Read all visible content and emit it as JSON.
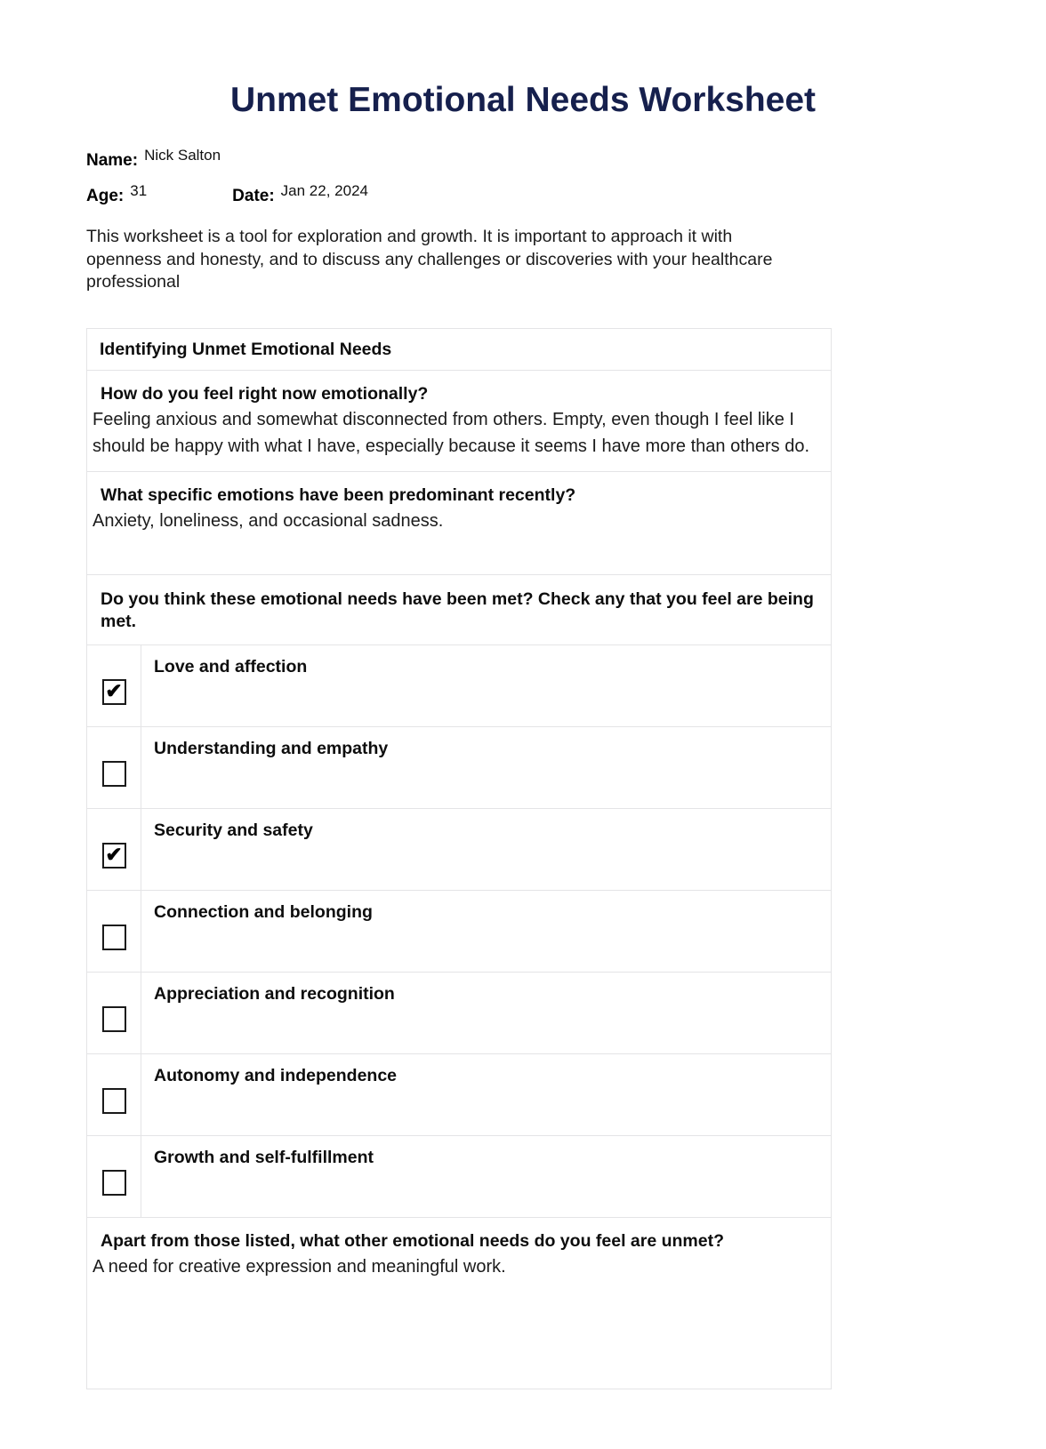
{
  "document": {
    "title": "Unmet Emotional Needs Worksheet",
    "title_color": "#16204d"
  },
  "identity": {
    "name_label": "Name:",
    "name_value": "Nick Salton",
    "age_label": "Age:",
    "age_value": "31",
    "date_label": "Date:",
    "date_value": "Jan 22, 2024"
  },
  "intro": {
    "text": "This worksheet is a tool for exploration and growth. It is important to approach it with openness and honesty, and to discuss any challenges or discoveries with your healthcare professional"
  },
  "section": {
    "header": "Identifying Unmet Emotional Needs",
    "questions": [
      {
        "question": "How do you feel right now emotionally?",
        "answer": "Feeling anxious and somewhat disconnected from others. Empty, even though I feel like I should be happy with what I have, especially because it seems I have more than others do."
      },
      {
        "question": "What specific emotions have been predominant recently?",
        "answer": "Anxiety, loneliness, and occasional sadness."
      }
    ],
    "checklist_prompt": "Do you think these emotional needs have been met? Check any that you feel are being met.",
    "checklist": [
      {
        "label": "Love and affection",
        "checked": true,
        "mark": "✔"
      },
      {
        "label": "Understanding and empathy",
        "checked": false,
        "mark": "✔"
      },
      {
        "label": "Security and safety",
        "checked": true,
        "mark": "✔"
      },
      {
        "label": "Connection and belonging",
        "checked": false,
        "mark": "✔"
      },
      {
        "label": "Appreciation and recognition",
        "checked": false,
        "mark": "✔"
      },
      {
        "label": "Autonomy and independence",
        "checked": false,
        "mark": "✔"
      },
      {
        "label": "Growth and self-fulfillment",
        "checked": false,
        "mark": "✔"
      }
    ],
    "final_question": {
      "question": "Apart from those listed, what other emotional needs do you feel are unmet?",
      "answer": "A need for creative expression and meaningful work."
    }
  }
}
